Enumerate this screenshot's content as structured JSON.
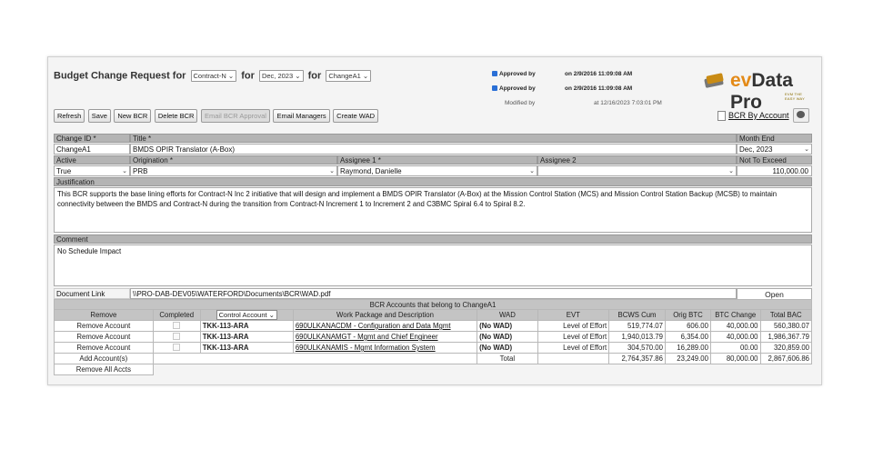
{
  "header": {
    "prefix": "Budget Change Request for",
    "contract_select": "Contract-N",
    "for1": "for",
    "period_select": "Dec, 2023",
    "for2": "for",
    "change_select": "ChangeA1"
  },
  "approvals": [
    {
      "label": "Approved by",
      "date": "on 2/9/2016 11:09:08 AM",
      "checked": true
    },
    {
      "label": "Approved by",
      "date": "on 2/9/2016 11:09:08 AM",
      "checked": true
    }
  ],
  "modified": {
    "label": "Modified by",
    "date": "at 12/16/2023 7:03:01 PM"
  },
  "logo": {
    "ev": "ev",
    "name": "Data Pro",
    "tagline": "EVM THE EASY WAY",
    "accent": "#e38a18"
  },
  "toolbar": {
    "refresh": "Refresh",
    "save": "Save",
    "new_bcr": "New BCR",
    "delete_bcr": "Delete BCR",
    "email_approval": "Email BCR Approval",
    "email_managers": "Email Managers",
    "create_wad": "Create WAD"
  },
  "bcr_by_account": "BCR By Account",
  "form": {
    "change_id_label": "Change ID *",
    "change_id": "ChangeA1",
    "title_label": "Title *",
    "title": "BMDS OPIR Translator (A-Box)",
    "month_end_label": "Month End",
    "month_end": "Dec, 2023",
    "active_label": "Active",
    "active": "True",
    "origination_label": "Origination *",
    "origination": "PRB",
    "assignee1_label": "Assignee 1 *",
    "assignee1": "Raymond, Danielle",
    "assignee2_label": "Assignee 2",
    "assignee2": "",
    "nte_label": "Not To Exceed",
    "nte": "110,000.00",
    "justification_label": "Justification",
    "justification": "This BCR supports the base lining efforts for Contract-N Inc 2 initiative that will design and implement a BMDS OPIR Translator (A-Box) at the Mission Control Station (MCS) and Mission Control Station Backup (MCSB) to maintain connectivity between the BMDS and Contract-N during the transition from Contract-N Increment 1 to Increment 2 and C3BMC Spiral 6.4 to Spiral 8.2.",
    "comment_label": "Comment",
    "comment": "No Schedule Impact",
    "doclink_label": "Document Link",
    "doclink": "\\\\PRO-DAB-DEV05\\WATERFORD\\Documents\\BCR\\WAD.pdf",
    "open": "Open"
  },
  "accounts": {
    "caption": "BCR Accounts that belong to ChangeA1",
    "headers": {
      "remove": "Remove",
      "completed": "Completed",
      "control_account": "Control Account",
      "work_package": "Work Package and Description",
      "wad": "WAD",
      "evt": "EVT",
      "bcws": "BCWS Cum",
      "orig_btc": "Orig BTC",
      "btc_change": "BTC Change",
      "total_bac": "Total BAC"
    },
    "rows": [
      {
        "remove": "Remove Account",
        "ca": "TKK-113-ARA",
        "wp": "690ULKANACDM - Configuration and Data Mgmt",
        "wad": "(No WAD)",
        "evt": "Level of Effort",
        "bcws": "519,774.07",
        "orig_btc": "606.00",
        "btc_change": "40,000.00",
        "total_bac": "560,380.07"
      },
      {
        "remove": "Remove Account",
        "ca": "TKK-113-ARA",
        "wp": "690ULKANAMGT - Mgmt and Chief Engineer",
        "wad": "(No WAD)",
        "evt": "Level of Effort",
        "bcws": "1,940,013.79",
        "orig_btc": "6,354.00",
        "btc_change": "40,000.00",
        "total_bac": "1,986,367.79"
      },
      {
        "remove": "Remove Account",
        "ca": "TKK-113-ARA",
        "wp": "690ULKANAMIS - Mgmt Information System",
        "wad": "(No WAD)",
        "evt": "Level of Effort",
        "bcws": "304,570.00",
        "orig_btc": "16,289.00",
        "btc_change": "00.00",
        "total_bac": "320,859.00"
      }
    ],
    "total_label": "Total",
    "totals": {
      "bcws": "2,764,357.86",
      "orig_btc": "23,249.00",
      "btc_change": "80,000.00",
      "total_bac": "2,867,606.86"
    },
    "add_accounts": "Add Account(s)",
    "remove_all": "Remove All Accts"
  }
}
